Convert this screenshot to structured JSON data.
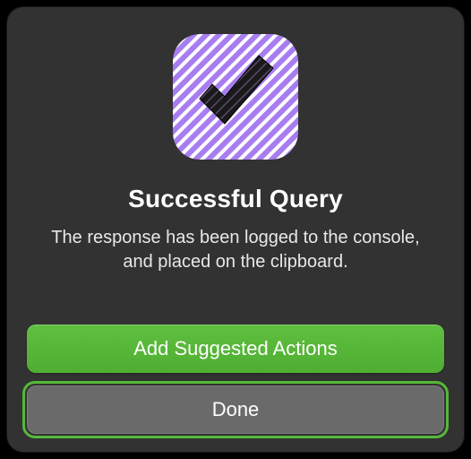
{
  "dialog": {
    "title": "Successful Query",
    "message": "The response has been logged to the console, and placed on the clipboard.",
    "primary_button_label": "Add Suggested Actions",
    "secondary_button_label": "Done"
  },
  "icon": {
    "name": "checkmark-app-icon",
    "bg_color": "#a87df0",
    "stripe_color": "#ffffff",
    "mark_color": "#1a1a1a"
  }
}
